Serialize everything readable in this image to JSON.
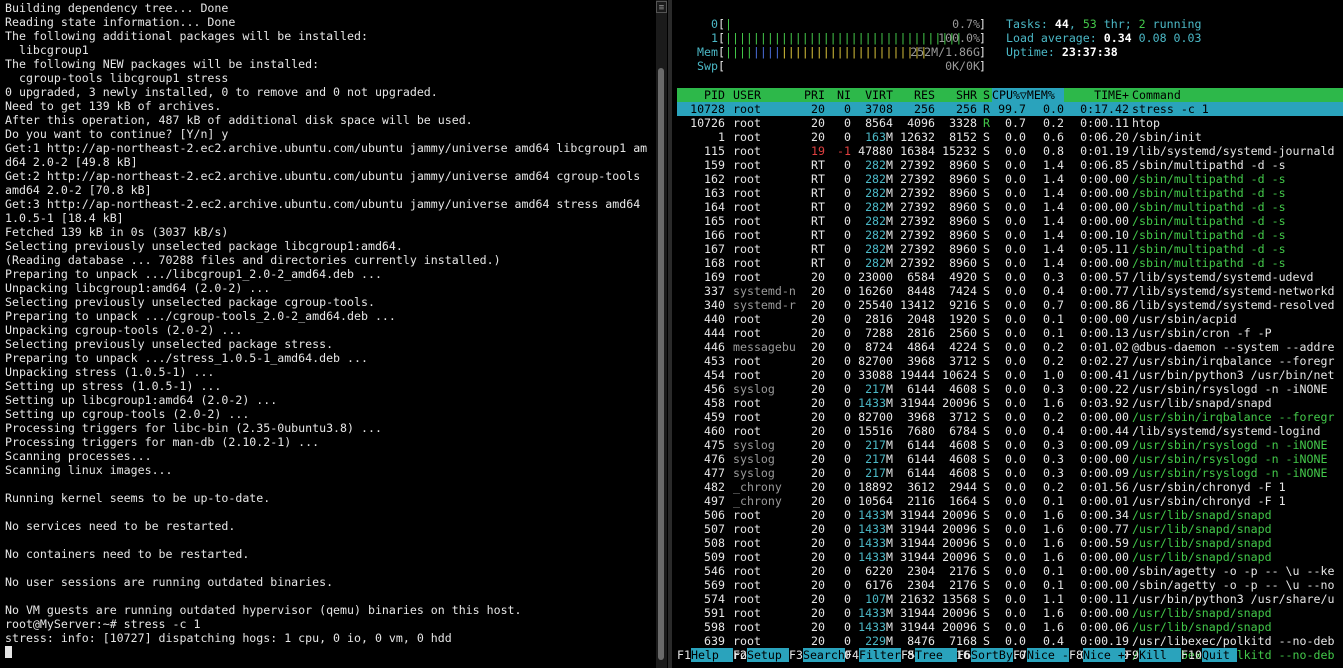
{
  "left": {
    "lines": [
      "Building dependency tree... Done",
      "Reading state information... Done",
      "The following additional packages will be installed:",
      "  libcgroup1",
      "The following NEW packages will be installed:",
      "  cgroup-tools libcgroup1 stress",
      "0 upgraded, 3 newly installed, 0 to remove and 0 not upgraded.",
      "Need to get 139 kB of archives.",
      "After this operation, 487 kB of additional disk space will be used.",
      "Do you want to continue? [Y/n] y",
      "Get:1 http://ap-northeast-2.ec2.archive.ubuntu.com/ubuntu jammy/universe amd64 libcgroup1 am",
      "d64 2.0-2 [49.8 kB]",
      "Get:2 http://ap-northeast-2.ec2.archive.ubuntu.com/ubuntu jammy/universe amd64 cgroup-tools",
      "amd64 2.0-2 [70.8 kB]",
      "Get:3 http://ap-northeast-2.ec2.archive.ubuntu.com/ubuntu jammy/universe amd64 stress amd64",
      "1.0.5-1 [18.4 kB]",
      "Fetched 139 kB in 0s (3037 kB/s)",
      "Selecting previously unselected package libcgroup1:amd64.",
      "(Reading database ... 70288 files and directories currently installed.)",
      "Preparing to unpack .../libcgroup1_2.0-2_amd64.deb ...",
      "Unpacking libcgroup1:amd64 (2.0-2) ...",
      "Selecting previously unselected package cgroup-tools.",
      "Preparing to unpack .../cgroup-tools_2.0-2_amd64.deb ...",
      "Unpacking cgroup-tools (2.0-2) ...",
      "Selecting previously unselected package stress.",
      "Preparing to unpack .../stress_1.0.5-1_amd64.deb ...",
      "Unpacking stress (1.0.5-1) ...",
      "Setting up stress (1.0.5-1) ...",
      "Setting up libcgroup1:amd64 (2.0-2) ...",
      "Setting up cgroup-tools (2.0-2) ...",
      "Processing triggers for libc-bin (2.35-0ubuntu3.8) ...",
      "Processing triggers for man-db (2.10.2-1) ...",
      "Scanning processes...",
      "Scanning linux images...",
      "",
      "Running kernel seems to be up-to-date.",
      "",
      "No services need to be restarted.",
      "",
      "No containers need to be restarted.",
      "",
      "No user sessions are running outdated binaries.",
      "",
      "No VM guests are running outdated hypervisor (qemu) binaries on this host.",
      "root@MyServer:~# stress -c 1",
      "stress: info: [10727] dispatching hogs: 1 cpu, 0 io, 0 vm, 0 hdd"
    ]
  },
  "htop": {
    "meters": [
      {
        "label": "0",
        "bar": "|",
        "value": "0.7%"
      },
      {
        "label": "1",
        "bar": "||||||||||||||||||||||||||||||||||",
        "value": "100.0%"
      },
      {
        "label": "Mem",
        "bar": "|||||||||||||||||||||||||||||",
        "value": "252M/1.86G"
      },
      {
        "label": "Swp",
        "bar": "",
        "value": "0K/0K"
      }
    ],
    "tasks_label": "Tasks: ",
    "tasks_total": "44",
    "tasks_sep1": ", ",
    "tasks_thr": "53",
    "tasks_thr_label": " thr; ",
    "tasks_running": "2",
    "tasks_running_label": " running",
    "load_label": "Load average: ",
    "load1": "0.34",
    "load5": "0.08",
    "load15": "0.03",
    "uptime_label": "Uptime: ",
    "uptime": "23:37:38",
    "columns": [
      "PID",
      "USER",
      "PRI",
      "NI",
      "VIRT",
      "RES",
      "SHR",
      "S",
      "CPU%▽MEM%",
      "TIME+",
      "Command"
    ],
    "processes": [
      {
        "pid": "10728",
        "user": "root",
        "pri": "20",
        "ni": "0",
        "virt": "3708",
        "res": "256",
        "shr": "256",
        "s": "R",
        "cpu": "99.7",
        "mem": "0.0",
        "time": "0:17.42",
        "cmd": "stress -c 1"
      },
      {
        "pid": "10726",
        "user": "root",
        "pri": "20",
        "ni": "0",
        "virt": "8564",
        "res": "4096",
        "shr": "3328",
        "s": "R",
        "cpu": "0.7",
        "mem": "0.2",
        "time": "0:00.11",
        "cmd": "htop"
      },
      {
        "pid": "1",
        "user": "root",
        "pri": "20",
        "ni": "0",
        "virt": "163M",
        "res": "12632",
        "shr": "8152",
        "s": "S",
        "cpu": "0.0",
        "mem": "0.6",
        "time": "0:06.20",
        "cmd": "/sbin/init"
      },
      {
        "pid": "115",
        "user": "root",
        "pri": "19",
        "ni": "-1",
        "virt": "47880",
        "res": "16384",
        "shr": "15232",
        "s": "S",
        "cpu": "0.0",
        "mem": "0.8",
        "time": "0:01.19",
        "cmd": "/lib/systemd/systemd-journald"
      },
      {
        "pid": "159",
        "user": "root",
        "pri": "RT",
        "ni": "0",
        "virt": "282M",
        "res": "27392",
        "shr": "8960",
        "s": "S",
        "cpu": "0.0",
        "mem": "1.4",
        "time": "0:06.85",
        "cmd": "/sbin/multipathd -d -s"
      },
      {
        "pid": "162",
        "user": "root",
        "pri": "RT",
        "ni": "0",
        "virt": "282M",
        "res": "27392",
        "shr": "8960",
        "s": "S",
        "cpu": "0.0",
        "mem": "1.4",
        "time": "0:00.00",
        "cmd": "/sbin/multipathd -d -s"
      },
      {
        "pid": "163",
        "user": "root",
        "pri": "RT",
        "ni": "0",
        "virt": "282M",
        "res": "27392",
        "shr": "8960",
        "s": "S",
        "cpu": "0.0",
        "mem": "1.4",
        "time": "0:00.00",
        "cmd": "/sbin/multipathd -d -s"
      },
      {
        "pid": "164",
        "user": "root",
        "pri": "RT",
        "ni": "0",
        "virt": "282M",
        "res": "27392",
        "shr": "8960",
        "s": "S",
        "cpu": "0.0",
        "mem": "1.4",
        "time": "0:00.00",
        "cmd": "/sbin/multipathd -d -s"
      },
      {
        "pid": "165",
        "user": "root",
        "pri": "RT",
        "ni": "0",
        "virt": "282M",
        "res": "27392",
        "shr": "8960",
        "s": "S",
        "cpu": "0.0",
        "mem": "1.4",
        "time": "0:00.00",
        "cmd": "/sbin/multipathd -d -s"
      },
      {
        "pid": "166",
        "user": "root",
        "pri": "RT",
        "ni": "0",
        "virt": "282M",
        "res": "27392",
        "shr": "8960",
        "s": "S",
        "cpu": "0.0",
        "mem": "1.4",
        "time": "0:00.10",
        "cmd": "/sbin/multipathd -d -s"
      },
      {
        "pid": "167",
        "user": "root",
        "pri": "RT",
        "ni": "0",
        "virt": "282M",
        "res": "27392",
        "shr": "8960",
        "s": "S",
        "cpu": "0.0",
        "mem": "1.4",
        "time": "0:05.11",
        "cmd": "/sbin/multipathd -d -s"
      },
      {
        "pid": "168",
        "user": "root",
        "pri": "RT",
        "ni": "0",
        "virt": "282M",
        "res": "27392",
        "shr": "8960",
        "s": "S",
        "cpu": "0.0",
        "mem": "1.4",
        "time": "0:00.00",
        "cmd": "/sbin/multipathd -d -s"
      },
      {
        "pid": "169",
        "user": "root",
        "pri": "20",
        "ni": "0",
        "virt": "23000",
        "res": "6584",
        "shr": "4920",
        "s": "S",
        "cpu": "0.0",
        "mem": "0.3",
        "time": "0:00.57",
        "cmd": "/lib/systemd/systemd-udevd"
      },
      {
        "pid": "337",
        "user": "systemd-n",
        "pri": "20",
        "ni": "0",
        "virt": "16260",
        "res": "8448",
        "shr": "7424",
        "s": "S",
        "cpu": "0.0",
        "mem": "0.4",
        "time": "0:00.77",
        "cmd": "/lib/systemd/systemd-networkd"
      },
      {
        "pid": "340",
        "user": "systemd-r",
        "pri": "20",
        "ni": "0",
        "virt": "25540",
        "res": "13412",
        "shr": "9216",
        "s": "S",
        "cpu": "0.0",
        "mem": "0.7",
        "time": "0:00.86",
        "cmd": "/lib/systemd/systemd-resolved"
      },
      {
        "pid": "440",
        "user": "root",
        "pri": "20",
        "ni": "0",
        "virt": "2816",
        "res": "2048",
        "shr": "1920",
        "s": "S",
        "cpu": "0.0",
        "mem": "0.1",
        "time": "0:00.00",
        "cmd": "/usr/sbin/acpid"
      },
      {
        "pid": "444",
        "user": "root",
        "pri": "20",
        "ni": "0",
        "virt": "7288",
        "res": "2816",
        "shr": "2560",
        "s": "S",
        "cpu": "0.0",
        "mem": "0.1",
        "time": "0:00.13",
        "cmd": "/usr/sbin/cron -f -P"
      },
      {
        "pid": "446",
        "user": "messagebu",
        "pri": "20",
        "ni": "0",
        "virt": "8724",
        "res": "4864",
        "shr": "4224",
        "s": "S",
        "cpu": "0.0",
        "mem": "0.2",
        "time": "0:01.02",
        "cmd": "@dbus-daemon --system --addre"
      },
      {
        "pid": "453",
        "user": "root",
        "pri": "20",
        "ni": "0",
        "virt": "82700",
        "res": "3968",
        "shr": "3712",
        "s": "S",
        "cpu": "0.0",
        "mem": "0.2",
        "time": "0:02.27",
        "cmd": "/usr/sbin/irqbalance --foregr"
      },
      {
        "pid": "454",
        "user": "root",
        "pri": "20",
        "ni": "0",
        "virt": "33088",
        "res": "19444",
        "shr": "10624",
        "s": "S",
        "cpu": "0.0",
        "mem": "1.0",
        "time": "0:00.41",
        "cmd": "/usr/bin/python3 /usr/bin/net"
      },
      {
        "pid": "456",
        "user": "syslog",
        "pri": "20",
        "ni": "0",
        "virt": "217M",
        "res": "6144",
        "shr": "4608",
        "s": "S",
        "cpu": "0.0",
        "mem": "0.3",
        "time": "0:00.22",
        "cmd": "/usr/sbin/rsyslogd -n -iNONE"
      },
      {
        "pid": "458",
        "user": "root",
        "pri": "20",
        "ni": "0",
        "virt": "1433M",
        "res": "31944",
        "shr": "20096",
        "s": "S",
        "cpu": "0.0",
        "mem": "1.6",
        "time": "0:03.92",
        "cmd": "/usr/lib/snapd/snapd"
      },
      {
        "pid": "459",
        "user": "root",
        "pri": "20",
        "ni": "0",
        "virt": "82700",
        "res": "3968",
        "shr": "3712",
        "s": "S",
        "cpu": "0.0",
        "mem": "0.2",
        "time": "0:00.00",
        "cmd": "/usr/sbin/irqbalance --foregr"
      },
      {
        "pid": "460",
        "user": "root",
        "pri": "20",
        "ni": "0",
        "virt": "15516",
        "res": "7680",
        "shr": "6784",
        "s": "S",
        "cpu": "0.0",
        "mem": "0.4",
        "time": "0:00.44",
        "cmd": "/lib/systemd/systemd-logind"
      },
      {
        "pid": "475",
        "user": "syslog",
        "pri": "20",
        "ni": "0",
        "virt": "217M",
        "res": "6144",
        "shr": "4608",
        "s": "S",
        "cpu": "0.0",
        "mem": "0.3",
        "time": "0:00.09",
        "cmd": "/usr/sbin/rsyslogd -n -iNONE"
      },
      {
        "pid": "476",
        "user": "syslog",
        "pri": "20",
        "ni": "0",
        "virt": "217M",
        "res": "6144",
        "shr": "4608",
        "s": "S",
        "cpu": "0.0",
        "mem": "0.3",
        "time": "0:00.00",
        "cmd": "/usr/sbin/rsyslogd -n -iNONE"
      },
      {
        "pid": "477",
        "user": "syslog",
        "pri": "20",
        "ni": "0",
        "virt": "217M",
        "res": "6144",
        "shr": "4608",
        "s": "S",
        "cpu": "0.0",
        "mem": "0.3",
        "time": "0:00.09",
        "cmd": "/usr/sbin/rsyslogd -n -iNONE"
      },
      {
        "pid": "482",
        "user": "_chrony",
        "pri": "20",
        "ni": "0",
        "virt": "18892",
        "res": "3612",
        "shr": "2944",
        "s": "S",
        "cpu": "0.0",
        "mem": "0.2",
        "time": "0:01.56",
        "cmd": "/usr/sbin/chronyd -F 1"
      },
      {
        "pid": "497",
        "user": "_chrony",
        "pri": "20",
        "ni": "0",
        "virt": "10564",
        "res": "2116",
        "shr": "1664",
        "s": "S",
        "cpu": "0.0",
        "mem": "0.1",
        "time": "0:00.01",
        "cmd": "/usr/sbin/chronyd -F 1"
      },
      {
        "pid": "506",
        "user": "root",
        "pri": "20",
        "ni": "0",
        "virt": "1433M",
        "res": "31944",
        "shr": "20096",
        "s": "S",
        "cpu": "0.0",
        "mem": "1.6",
        "time": "0:00.34",
        "cmd": "/usr/lib/snapd/snapd"
      },
      {
        "pid": "507",
        "user": "root",
        "pri": "20",
        "ni": "0",
        "virt": "1433M",
        "res": "31944",
        "shr": "20096",
        "s": "S",
        "cpu": "0.0",
        "mem": "1.6",
        "time": "0:00.77",
        "cmd": "/usr/lib/snapd/snapd"
      },
      {
        "pid": "508",
        "user": "root",
        "pri": "20",
        "ni": "0",
        "virt": "1433M",
        "res": "31944",
        "shr": "20096",
        "s": "S",
        "cpu": "0.0",
        "mem": "1.6",
        "time": "0:00.59",
        "cmd": "/usr/lib/snapd/snapd"
      },
      {
        "pid": "509",
        "user": "root",
        "pri": "20",
        "ni": "0",
        "virt": "1433M",
        "res": "31944",
        "shr": "20096",
        "s": "S",
        "cpu": "0.0",
        "mem": "1.6",
        "time": "0:00.00",
        "cmd": "/usr/lib/snapd/snapd"
      },
      {
        "pid": "546",
        "user": "root",
        "pri": "20",
        "ni": "0",
        "virt": "6220",
        "res": "2304",
        "shr": "2176",
        "s": "S",
        "cpu": "0.0",
        "mem": "0.1",
        "time": "0:00.00",
        "cmd": "/sbin/agetty -o -p -- \\u --ke"
      },
      {
        "pid": "569",
        "user": "root",
        "pri": "20",
        "ni": "0",
        "virt": "6176",
        "res": "2304",
        "shr": "2176",
        "s": "S",
        "cpu": "0.0",
        "mem": "0.1",
        "time": "0:00.00",
        "cmd": "/sbin/agetty -o -p -- \\u --no"
      },
      {
        "pid": "574",
        "user": "root",
        "pri": "20",
        "ni": "0",
        "virt": "107M",
        "res": "21632",
        "shr": "13568",
        "s": "S",
        "cpu": "0.0",
        "mem": "1.1",
        "time": "0:00.11",
        "cmd": "/usr/bin/python3 /usr/share/u"
      },
      {
        "pid": "591",
        "user": "root",
        "pri": "20",
        "ni": "0",
        "virt": "1433M",
        "res": "31944",
        "shr": "20096",
        "s": "S",
        "cpu": "0.0",
        "mem": "1.6",
        "time": "0:00.00",
        "cmd": "/usr/lib/snapd/snapd"
      },
      {
        "pid": "598",
        "user": "root",
        "pri": "20",
        "ni": "0",
        "virt": "1433M",
        "res": "31944",
        "shr": "20096",
        "s": "S",
        "cpu": "0.0",
        "mem": "1.6",
        "time": "0:00.06",
        "cmd": "/usr/lib/snapd/snapd"
      },
      {
        "pid": "639",
        "user": "root",
        "pri": "20",
        "ni": "0",
        "virt": "229M",
        "res": "8476",
        "shr": "7168",
        "s": "S",
        "cpu": "0.0",
        "mem": "0.4",
        "time": "0:00.19",
        "cmd": "/usr/libexec/polkitd --no-deb"
      },
      {
        "pid": "644",
        "user": "root",
        "pri": "20",
        "ni": "0",
        "virt": "229M",
        "res": "8476",
        "shr": "7168",
        "s": "S",
        "cpu": "0.0",
        "mem": "0.4",
        "time": "0:00.00",
        "cmd": "/usr/libexec/polkitd --no-deb"
      }
    ],
    "fkeys": [
      {
        "key": "F1",
        "label": "Help  "
      },
      {
        "key": "F2",
        "label": "Setup "
      },
      {
        "key": "F3",
        "label": "Search"
      },
      {
        "key": "F4",
        "label": "Filter"
      },
      {
        "key": "F5",
        "label": "Tree  "
      },
      {
        "key": "F6",
        "label": "SortBy"
      },
      {
        "key": "F7",
        "label": "Nice -"
      },
      {
        "key": "F8",
        "label": "Nice +"
      },
      {
        "key": "F9",
        "label": "Kill  "
      },
      {
        "key": "F10",
        "label": "Quit "
      }
    ],
    "colors": {
      "header_bg": "#2db84a",
      "selected_bg": "#2aa3bc",
      "thread_cmd": "#43c84a",
      "dim_user": "#9a9a9a"
    }
  }
}
